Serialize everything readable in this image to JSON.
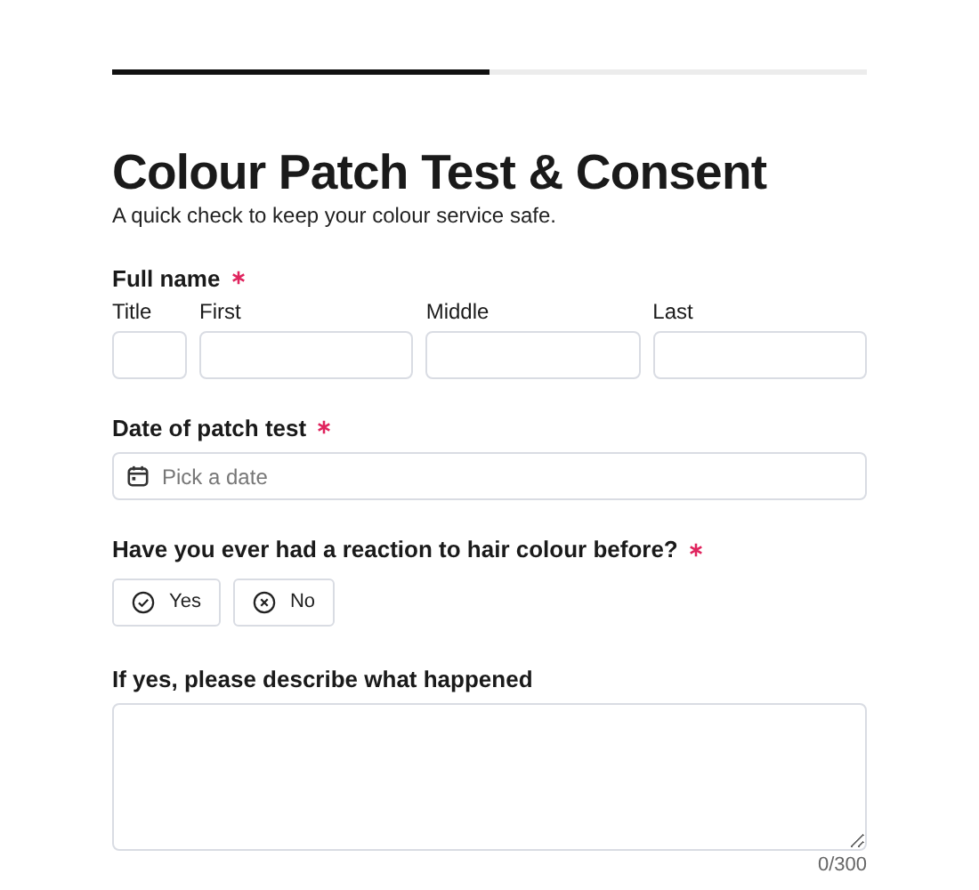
{
  "progress": {
    "level": 0.5
  },
  "title": "Colour Patch Test & Consent",
  "subtitle": "A quick check to keep your colour service safe.",
  "full_name": {
    "label": "Full name",
    "required": true,
    "parts": [
      {
        "label": "Title"
      },
      {
        "label": "First"
      },
      {
        "label": "Middle"
      },
      {
        "label": "Last"
      }
    ]
  },
  "date": {
    "label": "Date of patch test",
    "required": true,
    "placeholder": "Pick a date"
  },
  "reaction": {
    "label": "Have you ever had a reaction to hair colour before?",
    "required": true,
    "options": [
      {
        "label": "Yes",
        "kind": "check",
        "selected": false
      },
      {
        "label": "No",
        "kind": "cross",
        "selected": false
      }
    ]
  },
  "description": {
    "label": "If yes, please describe what happened",
    "counter": "0/300"
  }
}
